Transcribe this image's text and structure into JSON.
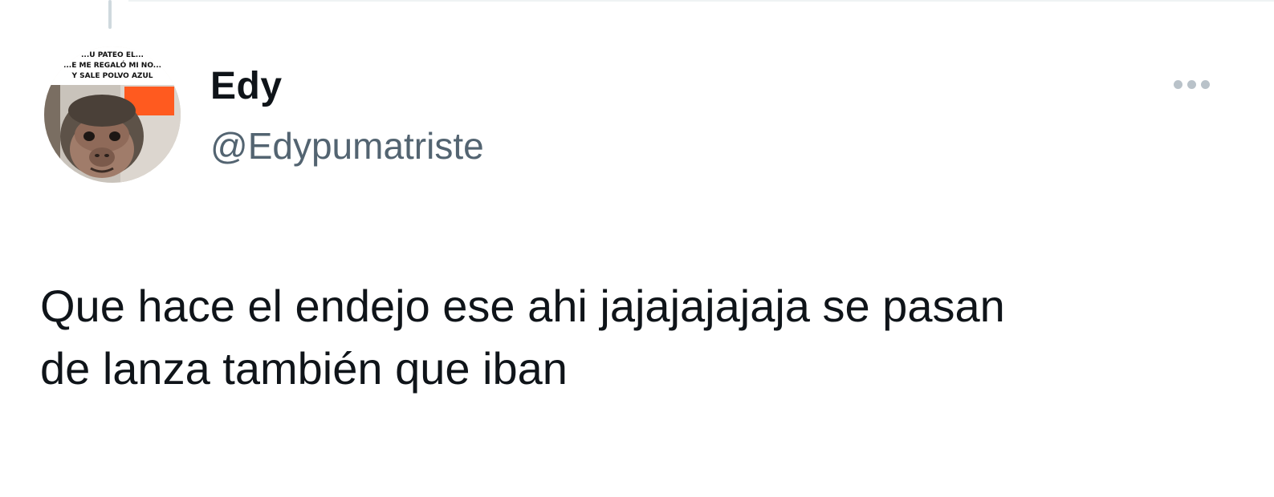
{
  "tweet": {
    "author": {
      "display_name": "Edy",
      "handle": "@Edypumatriste",
      "avatar": {
        "icon": "monkey-meme-avatar",
        "caption_lines": [
          "...U PATEO EL...",
          "...E ME REGALÓ MI NO...",
          "Y SALE POLVO AZUL"
        ]
      }
    },
    "more_icon": "more-horizontal-icon",
    "text": "Que hace el endejo ese ahi jajajajajaja se pasan\nde lanza también que iban"
  },
  "colors": {
    "text_primary": "#0f1419",
    "text_secondary": "#536471",
    "icon_muted": "#b9c2c9",
    "thread_line": "#cfd9de"
  }
}
